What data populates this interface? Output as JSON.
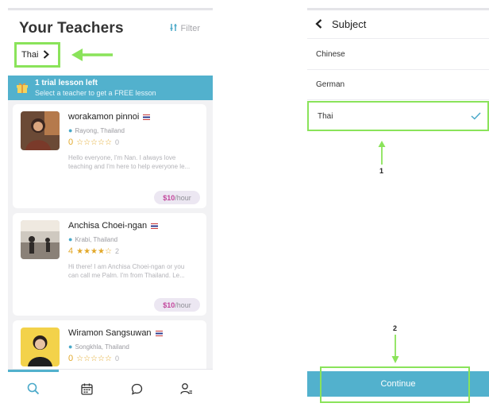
{
  "colors": {
    "accent": "#52b1cd",
    "highlight": "#8ae35a",
    "star": "#e2a82a",
    "price": "#c2479c"
  },
  "teachers_screen": {
    "title": "Your Teachers",
    "filter_label": "Filter",
    "filter_icon": "sliders-icon",
    "subject_chip": {
      "label": "Thai",
      "icon": "chevron-right-icon"
    },
    "trial_banner": {
      "icon": "gift-icon",
      "title": "1 trial lesson left",
      "subtitle": "Select a teacher to get a FREE lesson"
    },
    "teachers": [
      {
        "name": "worakamon pinnoi",
        "flag": "thai-flag",
        "location": "Rayong, Thailand",
        "rating": "0",
        "stars": "☆☆☆☆☆",
        "stars_filled": 0,
        "reviews": "0",
        "bio": "Hello everyone, I'm Nan. I always love teaching and I'm here to help everyone le...",
        "price_amount": "$10",
        "price_unit": "/hour"
      },
      {
        "name": "Anchisa Choei-ngan",
        "flag": "thai-flag",
        "location": "Krabi, Thailand",
        "rating": "4",
        "stars": "★★★★☆",
        "stars_filled": 4,
        "reviews": "2",
        "bio": "Hi there! I am Anchisa Choei-ngan or you can call me Palm. I'm from Thailand. Le...",
        "price_amount": "$10",
        "price_unit": "/hour"
      },
      {
        "name": "Wiramon Sangsuwan",
        "flag": "thai-flag",
        "location": "Songkhla, Thailand",
        "rating": "0",
        "stars": "☆☆☆☆☆",
        "stars_filled": 0,
        "reviews": "0"
      }
    ],
    "tabs": [
      {
        "icon": "search-icon",
        "active": true
      },
      {
        "icon": "calendar-icon",
        "active": false
      },
      {
        "icon": "chat-icon",
        "active": false
      },
      {
        "icon": "profile-icon",
        "active": false
      }
    ]
  },
  "subject_screen": {
    "back_icon": "chevron-left-icon",
    "title": "Subject",
    "options": [
      {
        "label": "Chinese",
        "selected": false
      },
      {
        "label": "German",
        "selected": false
      },
      {
        "label": "Thai",
        "selected": true
      }
    ],
    "check_icon": "checkmark-icon",
    "continue_label": "Continue"
  },
  "annotations": {
    "step1": "1",
    "step2": "2"
  }
}
